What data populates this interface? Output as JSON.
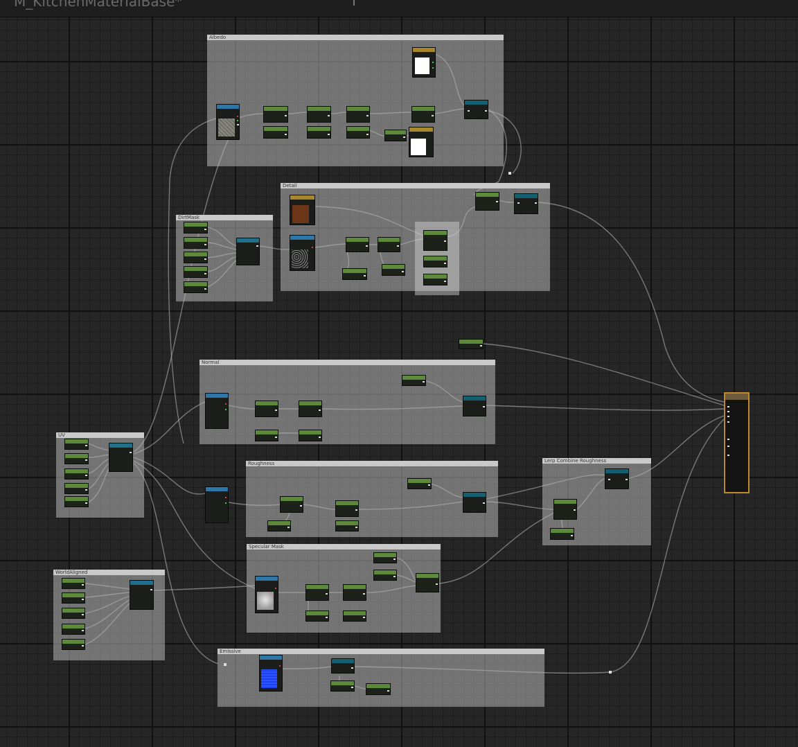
{
  "window": {
    "title": "M_KitchenMaterialBase*"
  },
  "comments": [
    {
      "id": "basecolor",
      "label": "Albedo"
    },
    {
      "id": "detail",
      "label": "Detail"
    },
    {
      "id": "dirtmask",
      "label": "DirtMask"
    },
    {
      "id": "normal",
      "label": "Normal"
    },
    {
      "id": "uv1",
      "label": "UV"
    },
    {
      "id": "roughness",
      "label": "Roughness"
    },
    {
      "id": "lerpblend",
      "label": "Lerp Combine Roughness"
    },
    {
      "id": "specular",
      "label": "Specular Mask"
    },
    {
      "id": "worldaligned",
      "label": "WorldAligned"
    },
    {
      "id": "emissive",
      "label": "Emissive"
    }
  ],
  "colors": {
    "graph_bg": "#262626",
    "param_header": "#5c8a3a",
    "function_header": "#1f6f8a",
    "texture_header": "#2c77a8",
    "constant_header": "#a8862c",
    "output_border": "#c08a2c",
    "wire": "#bdbdbd"
  }
}
